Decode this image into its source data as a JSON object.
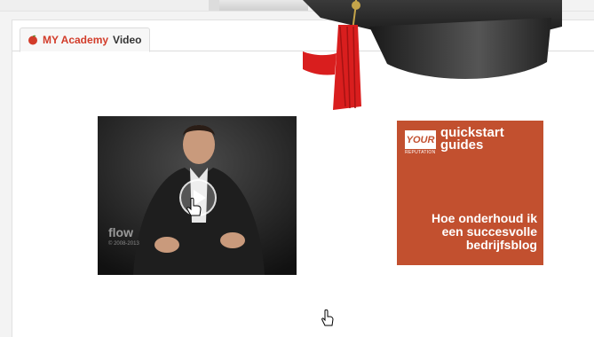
{
  "tab": {
    "brand": "MY Academy",
    "label": "Video"
  },
  "video": {
    "watermark": "flow",
    "copyright": "© 2008-2013"
  },
  "guide": {
    "logo": "YOUR",
    "logo_sub": "REPUTATION",
    "heading_line1": "quickstart",
    "heading_line2": "guides",
    "body_line1": "Hoe onderhoud ik",
    "body_line2": "een succesvolle",
    "body_line3": "bedrijfsblog"
  },
  "colors": {
    "brand": "#d23c2a",
    "guide_bg": "#c2502f",
    "tassel": "#d91e1e"
  },
  "icons": [
    "academy-icon",
    "play-icon",
    "hand-cursor-icon",
    "graduation-cap-icon",
    "pointer-cursor-icon"
  ]
}
